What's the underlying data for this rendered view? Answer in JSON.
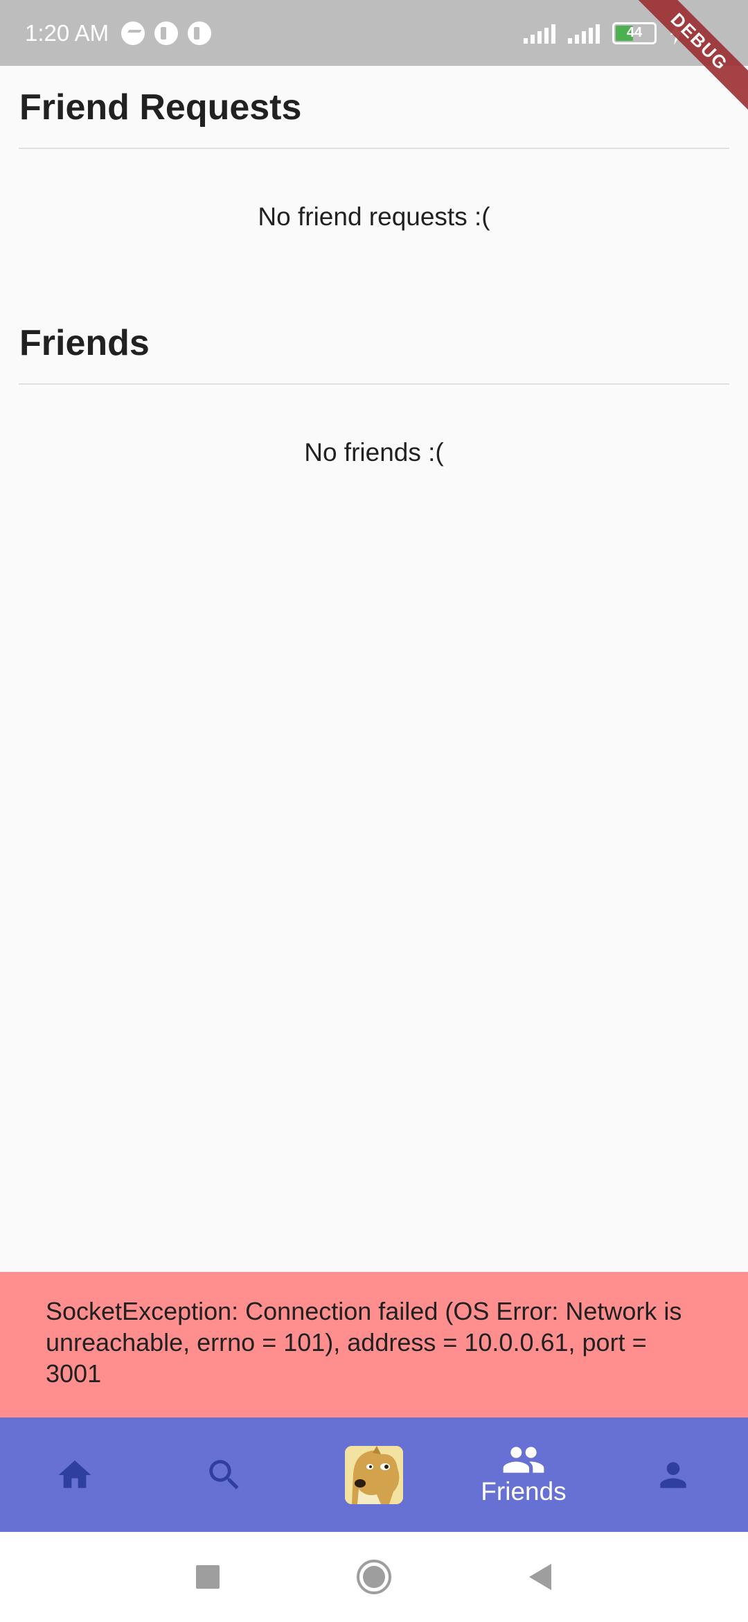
{
  "status_bar": {
    "time": "1:20 AM",
    "battery_level": "44",
    "battery_fraction": 0.44,
    "icons": [
      "messenger-icon",
      "app-notification-icon",
      "app-notification-icon",
      "signal-icon",
      "signal-icon",
      "battery-icon",
      "charging-icon"
    ]
  },
  "debug_banner": {
    "label": "DEBUG"
  },
  "friend_requests": {
    "title": "Friend Requests",
    "empty_message": "No friend requests :("
  },
  "friends": {
    "title": "Friends",
    "empty_message": "No friends :("
  },
  "error": {
    "message": "SocketException: Connection failed (OS Error: Network is unreachable, errno = 101), address = 10.0.0.61, port = 3001"
  },
  "bottom_nav": {
    "items": [
      {
        "icon": "home-icon",
        "label": "",
        "active": false
      },
      {
        "icon": "search-icon",
        "label": "",
        "active": false
      },
      {
        "icon": "doge-avatar",
        "label": "",
        "active": false
      },
      {
        "icon": "people-icon",
        "label": "Friends",
        "active": true
      },
      {
        "icon": "person-icon",
        "label": "",
        "active": false
      }
    ]
  },
  "system_nav": {
    "icons": [
      "recents-square-icon",
      "home-circle-icon",
      "back-triangle-icon"
    ]
  },
  "colors": {
    "status_bar": "#bdbdbd",
    "background": "#fafafa",
    "error_background": "#ff8f8f",
    "nav_background": "#6770d3",
    "nav_inactive_icon": "#2f3f9e",
    "nav_active": "#ffffff",
    "debug_banner": "#9c2f33"
  }
}
